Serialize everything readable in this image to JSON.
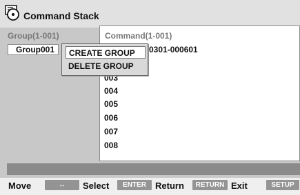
{
  "app": {
    "title": "Command Stack",
    "icon": "document-cd-icon"
  },
  "groups": {
    "header": "Group(1-001)",
    "items": [
      {
        "label": "Group001"
      }
    ]
  },
  "commands": {
    "header": "Command(1-001)",
    "first_range": "0301-000601",
    "items": [
      "003",
      "004",
      "005",
      "006",
      "007",
      "008"
    ]
  },
  "popup_menu": {
    "items": [
      {
        "label": "CREATE GROUP",
        "selected": true
      },
      {
        "label": "DELETE GROUP",
        "selected": false
      }
    ]
  },
  "hints": {
    "move_label": "Move",
    "move_key": "↔",
    "select_label": "Select",
    "select_key": "ENTER",
    "return_label": "Return",
    "return_key": "RETURN",
    "exit_label": "Exit",
    "exit_key": "SETUP"
  },
  "colors": {
    "frame": "#c8c8c8",
    "title_bar": "#e1e1e1",
    "status_bar": "#8b8b8b",
    "key_bg": "#949494"
  }
}
